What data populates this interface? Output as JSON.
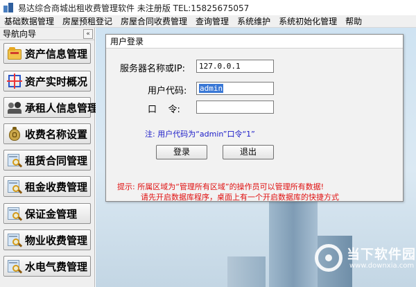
{
  "app": {
    "title": "易达综合商城出租收费管理软件   未注册版 TEL:15825675057"
  },
  "menu": {
    "items": [
      "基础数据管理",
      "房屋预租登记",
      "房屋合同收费管理",
      "查询管理",
      "系统维护",
      "系统初始化管理",
      "帮助"
    ]
  },
  "sidebar": {
    "title": "导航向导",
    "collapse_glyph": "«",
    "items": [
      {
        "label": "资产信息管理",
        "icon": "folder-icon"
      },
      {
        "label": "资产实时概况",
        "icon": "arrows-icon"
      },
      {
        "label": "承租人信息管理",
        "icon": "people-icon"
      },
      {
        "label": "收费名称设置",
        "icon": "money-bag-icon"
      },
      {
        "label": "租赁合同管理",
        "icon": "search-icon"
      },
      {
        "label": "租金收费管理",
        "icon": "search-icon"
      },
      {
        "label": "保证金管理",
        "icon": "search-icon"
      },
      {
        "label": "物业收费管理",
        "icon": "search-icon"
      },
      {
        "label": "水电气费管理",
        "icon": "search-icon"
      }
    ]
  },
  "login": {
    "title": "用户登录",
    "server_label": "服务器名称或IP:",
    "server_value": "127.0.0.1",
    "user_label": "用户代码:",
    "user_value": "admin",
    "password_label": "口    令:",
    "password_value": "",
    "note": "注: 用户代码为“admin”口令“1”",
    "login_button": "登录",
    "exit_button": "退出",
    "tip_line1": "提示: 所属区域为“管理所有区域”的操作员可以管理所有数据!",
    "tip_line2": "请先开启数据库程序，桌面上有一个开启数据库的快捷方式"
  },
  "watermark": {
    "text": "当下软件园",
    "url": "www.downxia.com"
  }
}
